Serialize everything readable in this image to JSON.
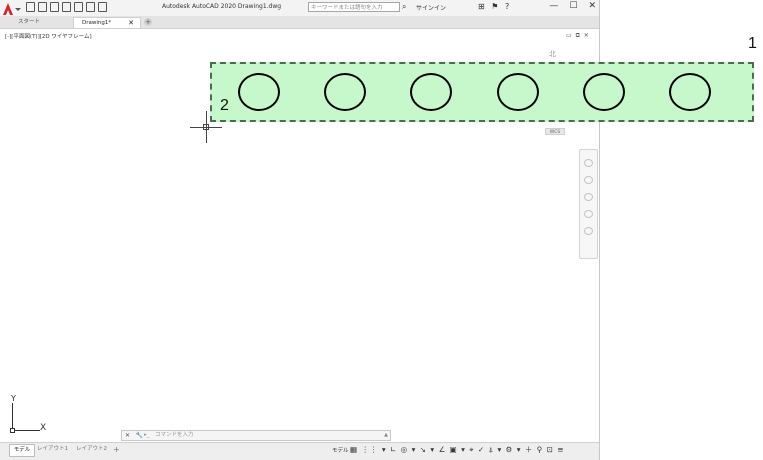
{
  "window": {
    "title": "Autodesk AutoCAD 2020   Drawing1.dwg",
    "search_placeholder": "キーワードまたは語句を入力",
    "signin_label": "サインイン",
    "search_icon": "binoculars-icon",
    "help_label": "?",
    "controls": {
      "minimize": "—",
      "maximize": "☐",
      "close": "✕"
    }
  },
  "tabs": [
    {
      "label": "スタート"
    },
    {
      "label": "Drawing1*",
      "close": "✕"
    }
  ],
  "tab_plus": "+",
  "viewport": {
    "label": "[-][平面図(T)][2D ワイヤフレーム]",
    "controls": "▭ ⧉ ✕",
    "north_label": "北",
    "wcs_label": "WCS"
  },
  "annotations": {
    "one": "1",
    "two": "2"
  },
  "highlight": {
    "fill": "#c6f8cc",
    "border": "#4d6b4f",
    "circle_count": 6
  },
  "ucs": {
    "y": "Y",
    "x": "X"
  },
  "command_line": {
    "buttons": "✕ 🔧",
    "placeholder": "コマンドを入力",
    "prompt_icon": "▸_",
    "history_toggle": "▲"
  },
  "layout_tabs": {
    "model": "モデル",
    "layout1": "レイアウト1",
    "layout2": "レイアウト2",
    "add": "+"
  },
  "status": {
    "model": "モデル",
    "icons": "▦ ⋮⋮ ▾ ∟ ◎ ▾ ↘ ▾ ∠ ▣ ▾ ⌖ ✓ ⍋ ▾ ⚙ ▾ ＋ ⚲ ⊡ ≡"
  }
}
